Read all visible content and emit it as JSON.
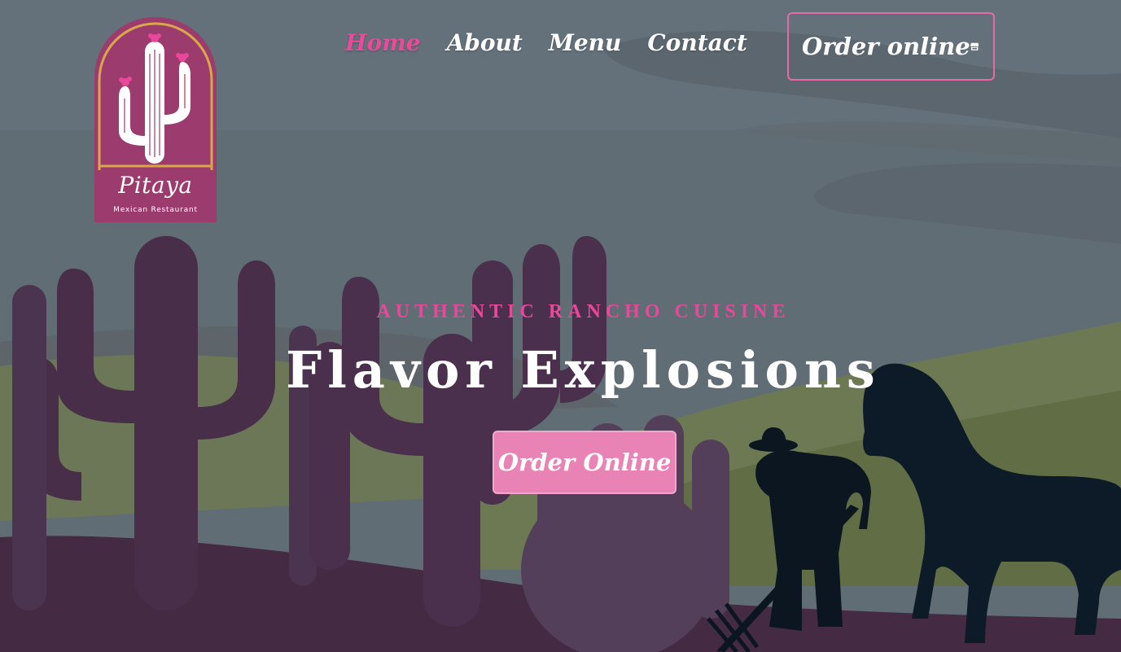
{
  "logo": {
    "name": "Pitaya",
    "tagline": "Mexican Restaurant"
  },
  "nav": {
    "items": [
      {
        "label": "Home",
        "active": true
      },
      {
        "label": "About",
        "active": false
      },
      {
        "label": "Menu",
        "active": false
      },
      {
        "label": "Contact",
        "active": false
      }
    ]
  },
  "header": {
    "order_label": "Order online",
    "order_icon": "store-icon"
  },
  "hero": {
    "tagline": "AUTHENTIC RANCHO CUISINE",
    "headline": "Flavor Explosions",
    "cta_label": "Order Online"
  },
  "colors": {
    "accent": "#e8489a",
    "cta_bg": "#e983b6",
    "logo_bg": "#9b3b6e",
    "logo_border": "#d9a74a"
  }
}
